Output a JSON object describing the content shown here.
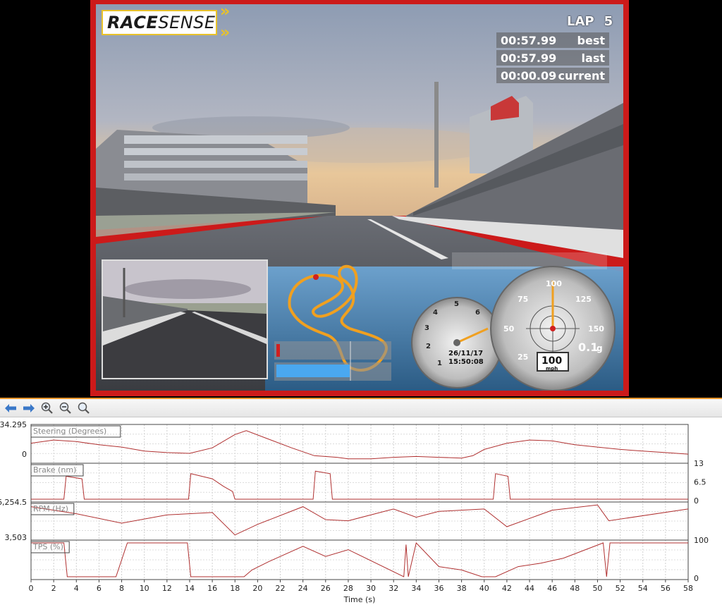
{
  "overlay": {
    "logo_bold": "RACE",
    "logo_light": "SENSE",
    "lap_label": "LAP",
    "lap_number": "5",
    "timing": [
      {
        "time": "00:57.99",
        "label": "best"
      },
      {
        "time": "00:57.99",
        "label": "last"
      },
      {
        "time": "00:00.09",
        "label": "current"
      }
    ],
    "date": "26/11/17",
    "clock": "15:50:08",
    "speed": "100",
    "speed_unit": "mph",
    "g_force": "0.1",
    "g_unit": "g",
    "rpm_ticks": [
      "1",
      "2",
      "3",
      "4",
      "5",
      "6"
    ],
    "speed_ticks": [
      "25",
      "50",
      "75",
      "100",
      "125",
      "150"
    ],
    "colors": {
      "frame": "#cc1a1a",
      "logo_accent": "#e8c22a",
      "track": "#f0a020",
      "needle": "#f0a020",
      "bar": "#4aa8f0",
      "brake": "#d02020"
    }
  },
  "toolbar": [
    {
      "name": "back-arrow-icon"
    },
    {
      "name": "forward-arrow-icon"
    },
    {
      "name": "zoom-in-icon"
    },
    {
      "name": "zoom-out-icon"
    },
    {
      "name": "zoom-fit-icon"
    }
  ],
  "chart_data": {
    "type": "line",
    "xlabel": "Time (s)",
    "xlim": [
      0,
      58
    ],
    "x_ticks": [
      0,
      2,
      4,
      6,
      8,
      10,
      12,
      14,
      16,
      18,
      20,
      22,
      24,
      26,
      28,
      30,
      32,
      34,
      36,
      38,
      40,
      42,
      44,
      46,
      48,
      50,
      52,
      54,
      56,
      58
    ],
    "grid": true,
    "line_color": "#b03030",
    "panels": [
      {
        "name": "Steering (Degrees)",
        "left_ticks": [
          "34.295",
          "0"
        ],
        "right_ticks": [],
        "ylim": [
          -8,
          34.295
        ],
        "x": [
          0,
          2,
          4,
          6,
          8,
          10,
          12,
          14,
          16,
          18,
          19,
          21,
          23,
          25,
          27,
          28,
          30,
          32,
          34,
          36,
          38,
          39,
          40,
          42,
          44,
          46,
          48,
          50,
          52,
          54,
          56,
          58
        ],
        "values": [
          14,
          18,
          16,
          12,
          9,
          4,
          2,
          1,
          8,
          25,
          30,
          19,
          8,
          -2,
          -4,
          -6,
          -6,
          -4,
          -3,
          -4,
          -5,
          -2,
          6,
          14,
          18,
          17,
          12,
          9,
          6,
          4,
          2,
          0
        ]
      },
      {
        "name": "Brake (nm)",
        "left_ticks": [],
        "right_ticks": [
          "13",
          "6.5",
          "0"
        ],
        "ylim": [
          0,
          13
        ],
        "x": [
          0,
          2.9,
          3.1,
          4.5,
          4.7,
          13.9,
          14.1,
          16,
          17,
          17.8,
          18,
          24.9,
          25.1,
          26.4,
          26.6,
          40.8,
          41,
          42.1,
          42.3,
          58
        ],
        "values": [
          0,
          0,
          9,
          8,
          0,
          0,
          10,
          8,
          5,
          3,
          0,
          0,
          11,
          10,
          0,
          0,
          10,
          9,
          0,
          0
        ]
      },
      {
        "name": "RPM (Hz)",
        "left_ticks": [
          "6,254.5",
          "3,503"
        ],
        "right_ticks": [],
        "ylim": [
          3503,
          6254.5
        ],
        "x": [
          0,
          4,
          8,
          12,
          16,
          18,
          20,
          24,
          26,
          28,
          32,
          34,
          36,
          40,
          42,
          44,
          46,
          50,
          51,
          58
        ],
        "values": [
          6100,
          5500,
          4700,
          5400,
          5600,
          3700,
          4600,
          6100,
          5000,
          4900,
          5900,
          5200,
          5700,
          5900,
          4400,
          5100,
          5800,
          6250,
          4900,
          5900
        ]
      },
      {
        "name": "TPS (%)",
        "left_ticks": [],
        "right_ticks": [
          "100",
          "0"
        ],
        "ylim": [
          0,
          100
        ],
        "x": [
          0,
          2.9,
          3.2,
          7.5,
          8.5,
          13.8,
          14.1,
          18.8,
          19.5,
          21,
          24,
          26,
          28,
          32.9,
          33.1,
          33.3,
          34,
          36,
          38,
          39.8,
          41,
          43,
          45,
          47,
          50.5,
          50.8,
          51.1,
          58
        ],
        "values": [
          100,
          100,
          0,
          0,
          100,
          100,
          0,
          0,
          20,
          45,
          90,
          60,
          80,
          0,
          95,
          0,
          100,
          30,
          20,
          0,
          0,
          30,
          40,
          55,
          100,
          0,
          100,
          100
        ]
      }
    ]
  }
}
